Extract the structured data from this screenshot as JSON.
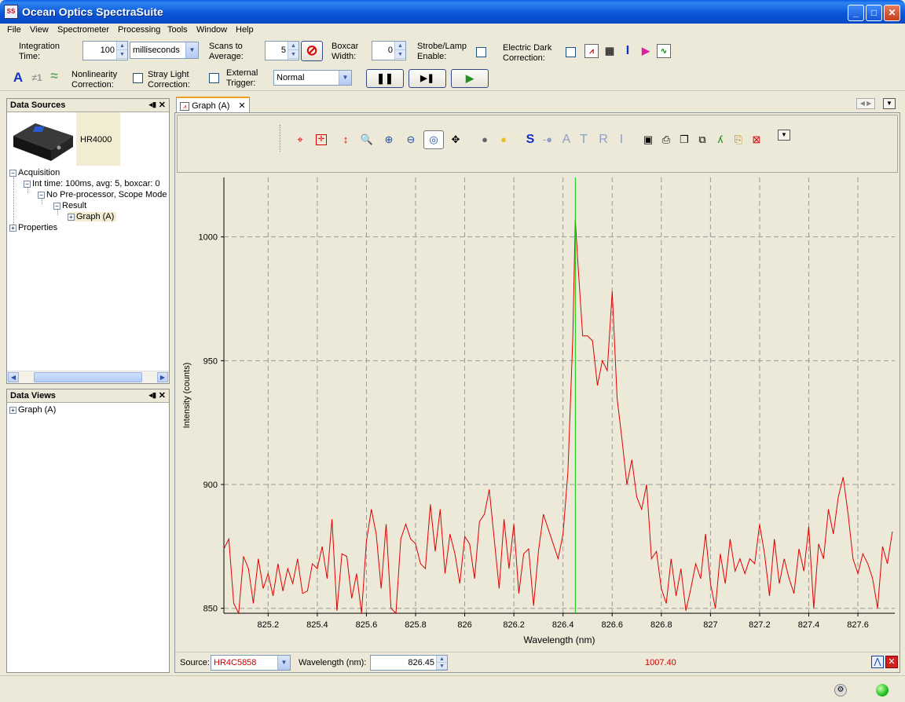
{
  "window": {
    "title": "Ocean Optics SpectraSuite",
    "app_icon": "SS"
  },
  "menu": [
    "File",
    "View",
    "Spectrometer",
    "Processing",
    "Tools",
    "Window",
    "Help"
  ],
  "toolbar": {
    "integration_time_label_1": "Integration",
    "integration_time_label_2": "Time:",
    "integration_time_value": "100",
    "integration_unit": "milliseconds",
    "scans_label_1": "Scans to",
    "scans_label_2": "Average:",
    "scans_value": "5",
    "boxcar_label_1": "Boxcar",
    "boxcar_label_2": "Width:",
    "boxcar_value": "0",
    "strobe_label_1": "Strobe/Lamp",
    "strobe_label_2": "Enable:",
    "dark_label_1": "Electric Dark",
    "dark_label_2": "Correction:",
    "nonlin_label_1": "Nonlinearity",
    "nonlin_label_2": "Correction:",
    "stray_label_1": "Stray Light",
    "stray_label_2": "Correction:",
    "trigger_label_1": "External",
    "trigger_label_2": "Trigger:",
    "trigger_mode": "Normal",
    "glyph_a": "A",
    "glyph_neq": "≠1",
    "glyph_wave": "≈"
  },
  "data_sources": {
    "title": "Data Sources",
    "device_name": "HR4000",
    "tree": {
      "acquisition": "Acquisition",
      "int_time": "Int time: 100ms, avg: 5, boxcar: 0",
      "preprocessor": "No Pre-processor, Scope Mode",
      "result": "Result",
      "graph": "Graph (A)",
      "properties": "Properties"
    }
  },
  "data_views": {
    "title": "Data Views",
    "graph": "Graph (A)"
  },
  "graph_tab": {
    "label": "Graph (A)"
  },
  "graph_toolbar": {
    "letters": [
      "S",
      "A",
      "T",
      "R",
      "I"
    ]
  },
  "status": {
    "source_label": "Source:",
    "source_value": "HR4C5858",
    "wavelength_label": "Wavelength (nm):",
    "wavelength_value": "826.45",
    "intensity_value": "1007.40"
  },
  "chart_data": {
    "type": "line",
    "xlabel": "Wavelength (nm)",
    "ylabel": "Intensity (counts)",
    "xlim": [
      825.02,
      827.75
    ],
    "ylim": [
      848,
      1024
    ],
    "x_ticks": [
      825.2,
      825.4,
      825.6,
      825.8,
      826,
      826.2,
      826.4,
      826.6,
      826.8,
      827,
      827.2,
      827.4,
      827.6
    ],
    "x_tick_labels": [
      "825.2",
      "825.4",
      "825.6",
      "825.8",
      "826",
      "826.2",
      "826.4",
      "826.6",
      "826.8",
      "827",
      "827.2",
      "827.4",
      "827.6"
    ],
    "y_ticks": [
      850,
      900,
      950,
      1000
    ],
    "y_tick_labels": [
      "850",
      "900",
      "950",
      "1000"
    ],
    "grid": true,
    "cursor_x": 826.45,
    "series": [
      {
        "color": "#e00000",
        "x": [
          825.02,
          825.04,
          825.06,
          825.08,
          825.1,
          825.12,
          825.14,
          825.16,
          825.18,
          825.2,
          825.22,
          825.24,
          825.26,
          825.28,
          825.3,
          825.32,
          825.34,
          825.36,
          825.38,
          825.4,
          825.42,
          825.44,
          825.46,
          825.48,
          825.5,
          825.52,
          825.54,
          825.56,
          825.58,
          825.6,
          825.62,
          825.64,
          825.66,
          825.68,
          825.7,
          825.72,
          825.74,
          825.76,
          825.78,
          825.8,
          825.82,
          825.84,
          825.86,
          825.88,
          825.9,
          825.92,
          825.94,
          825.96,
          825.98,
          826.0,
          826.02,
          826.04,
          826.06,
          826.08,
          826.1,
          826.12,
          826.14,
          826.16,
          826.18,
          826.2,
          826.22,
          826.24,
          826.26,
          826.28,
          826.3,
          826.32,
          826.34,
          826.36,
          826.38,
          826.4,
          826.42,
          826.44,
          826.45,
          826.46,
          826.48,
          826.5,
          826.52,
          826.54,
          826.56,
          826.58,
          826.6,
          826.62,
          826.64,
          826.66,
          826.68,
          826.7,
          826.72,
          826.74,
          826.76,
          826.78,
          826.8,
          826.82,
          826.84,
          826.86,
          826.88,
          826.9,
          826.92,
          826.94,
          826.96,
          826.98,
          827.0,
          827.02,
          827.04,
          827.06,
          827.08,
          827.1,
          827.12,
          827.14,
          827.16,
          827.18,
          827.2,
          827.22,
          827.24,
          827.26,
          827.28,
          827.3,
          827.32,
          827.34,
          827.36,
          827.38,
          827.4,
          827.42,
          827.44,
          827.46,
          827.48,
          827.5,
          827.52,
          827.54,
          827.56,
          827.58,
          827.6,
          827.62,
          827.64,
          827.66,
          827.68,
          827.7,
          827.72,
          827.74
        ],
        "y": [
          874,
          878,
          852,
          848,
          871,
          866,
          852,
          870,
          858,
          864,
          855,
          868,
          857,
          866,
          860,
          870,
          856,
          857,
          868,
          866,
          875,
          862,
          886,
          849,
          872,
          871,
          854,
          864,
          848,
          877,
          890,
          880,
          858,
          884,
          850,
          848,
          878,
          884,
          878,
          876,
          868,
          866,
          892,
          873,
          890,
          864,
          880,
          872,
          860,
          879,
          876,
          862,
          885,
          888,
          898,
          878,
          858,
          886,
          866,
          884,
          856,
          872,
          874,
          851,
          873,
          888,
          882,
          876,
          870,
          880,
          905,
          960,
          1007,
          990,
          960,
          960,
          958,
          940,
          950,
          946,
          978,
          935,
          918,
          900,
          910,
          895,
          890,
          900,
          870,
          873,
          858,
          852,
          870,
          855,
          866,
          849,
          858,
          868,
          862,
          880,
          860,
          850,
          872,
          860,
          878,
          865,
          870,
          864,
          870,
          868,
          884,
          872,
          855,
          878,
          860,
          870,
          862,
          856,
          874,
          865,
          883,
          850,
          876,
          870,
          890,
          880,
          895,
          903,
          888,
          870,
          864,
          872,
          868,
          862,
          850,
          875,
          868,
          881
        ]
      }
    ]
  }
}
